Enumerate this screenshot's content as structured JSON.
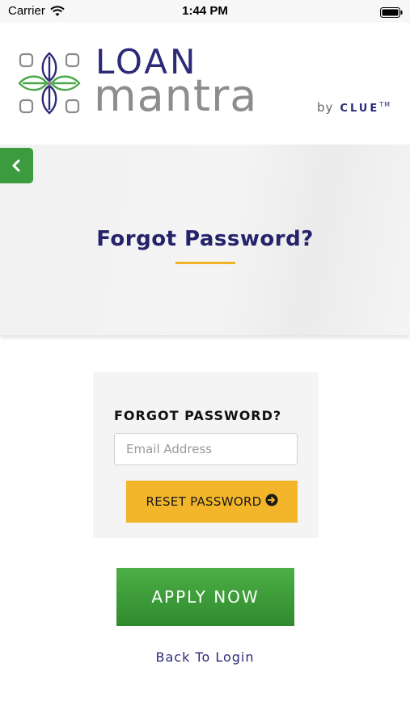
{
  "status_bar": {
    "carrier": "Carrier",
    "time": "1:44 PM"
  },
  "brand": {
    "word1": "LOAN",
    "word2": "mantra",
    "by": "by",
    "partner": "CLUE",
    "trademark": "TM"
  },
  "banner": {
    "title": "Forgot Password?",
    "accent_color": "#f0b323"
  },
  "form": {
    "heading": "FORGOT PASSWORD?",
    "email_placeholder": "Email Address",
    "email_value": "",
    "reset_label": "RESET PASSWORD"
  },
  "actions": {
    "apply_label": "APPLY NOW",
    "back_to_login": "Back To Login"
  },
  "colors": {
    "primary_navy": "#2d2a78",
    "green": "#3c9b3f",
    "yellow": "#f3b52a"
  },
  "icons": {
    "back": "chevron-left-icon",
    "reset": "arrow-circle-right-icon",
    "wifi": "wifi-icon",
    "battery": "battery-icon"
  }
}
